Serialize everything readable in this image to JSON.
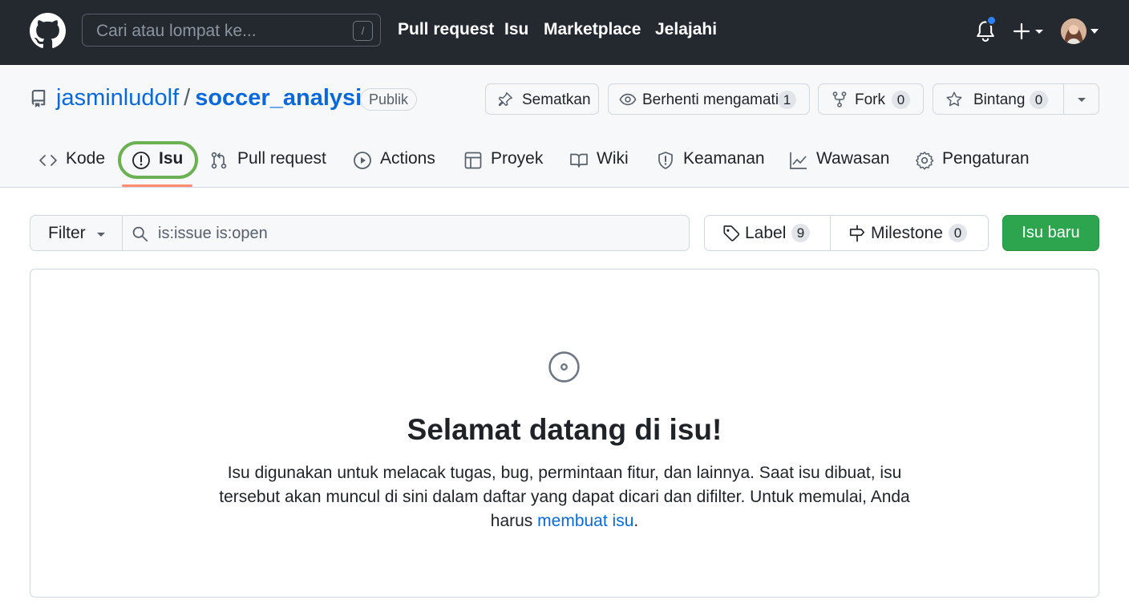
{
  "header": {
    "search_placeholder": "Cari atau lompat ke...",
    "search_key": "/",
    "nav": [
      "Pull request",
      "Isu",
      "Marketplace",
      "Jelajahi"
    ],
    "notification_dot_color": "#2f81f7"
  },
  "repo": {
    "owner": "jasminludolf",
    "separator": "/",
    "name": "soccer_analysis",
    "visibility": "Publik",
    "pin_label": "Sematkan",
    "watch_label": "Berhenti mengamati",
    "watch_count": "1",
    "fork_label": "Fork",
    "fork_count": "0",
    "star_label": "Bintang",
    "star_count": "0"
  },
  "tabs": {
    "code": "Kode",
    "issues": "Isu",
    "pulls": "Pull request",
    "actions": "Actions",
    "projects": "Proyek",
    "wiki": "Wiki",
    "security": "Keamanan",
    "insights": "Wawasan",
    "settings": "Pengaturan",
    "active": "issues",
    "highlight_color": "#6cb154"
  },
  "filterbar": {
    "filter_label": "Filter",
    "query": "is:issue is:open",
    "labels_label": "Label",
    "labels_count": "9",
    "milestones_label": "Milestone",
    "milestones_count": "0",
    "new_issue_label": "Isu baru"
  },
  "blankslate": {
    "title": "Selamat datang di isu!",
    "text_before": "Isu digunakan untuk melacak tugas, bug, permintaan fitur, dan lainnya. Saat isu dibuat, isu tersebut akan muncul di sini dalam daftar yang dapat dicari dan difilter. Untuk memulai, Anda harus ",
    "link": "membuat isu",
    "text_after": "."
  },
  "colors": {
    "header_bg": "#24292f",
    "link": "#0969da",
    "primary_button": "#2da44e",
    "active_tab_underline": "#fd8c73"
  }
}
